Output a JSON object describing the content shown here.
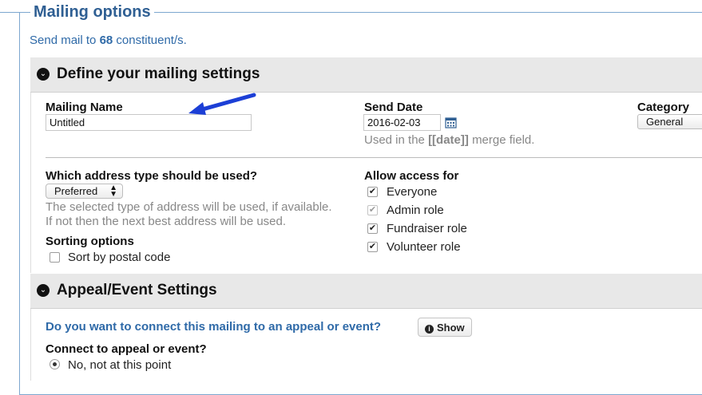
{
  "legend": "Mailing options",
  "send_mail": {
    "prefix": "Send mail to",
    "count": "68",
    "suffix": "constituent/s."
  },
  "section1": {
    "title": "Define your mailing settings",
    "mailing_name": {
      "label": "Mailing Name",
      "value": "Untitled"
    },
    "send_date": {
      "label": "Send Date",
      "value": "2016-02-03",
      "hint_prefix": "Used in the",
      "hint_field": "[[date]]",
      "hint_suffix": "merge field."
    },
    "category": {
      "label": "Category",
      "value": "General"
    },
    "address": {
      "label": "Which address type should be used?",
      "value": "Preferred",
      "hint_line1": "The selected type of address will be used, if available.",
      "hint_line2": "If not then the next best address will be used."
    },
    "sorting": {
      "label": "Sorting options",
      "option": "Sort by postal code",
      "checked": false
    },
    "access": {
      "label": "Allow access for",
      "options": [
        {
          "label": "Everyone",
          "checked": true,
          "disabled": false
        },
        {
          "label": "Admin role",
          "checked": true,
          "disabled": true
        },
        {
          "label": "Fundraiser role",
          "checked": true,
          "disabled": false
        },
        {
          "label": "Volunteer role",
          "checked": true,
          "disabled": false
        }
      ]
    }
  },
  "section2": {
    "title": "Appeal/Event Settings",
    "question": "Do you want to connect this mailing to an appeal or event?",
    "show_label": "Show",
    "connect_label": "Connect to appeal or event?",
    "option_no": "No, not at this point"
  },
  "colors": {
    "accent": "#2f6aa8",
    "header_bg": "#e8e8e8",
    "arrow": "#1c3fd6"
  },
  "icons": [
    "chevron-down-icon",
    "calendar-icon",
    "info-icon",
    "arrow-annotation"
  ]
}
